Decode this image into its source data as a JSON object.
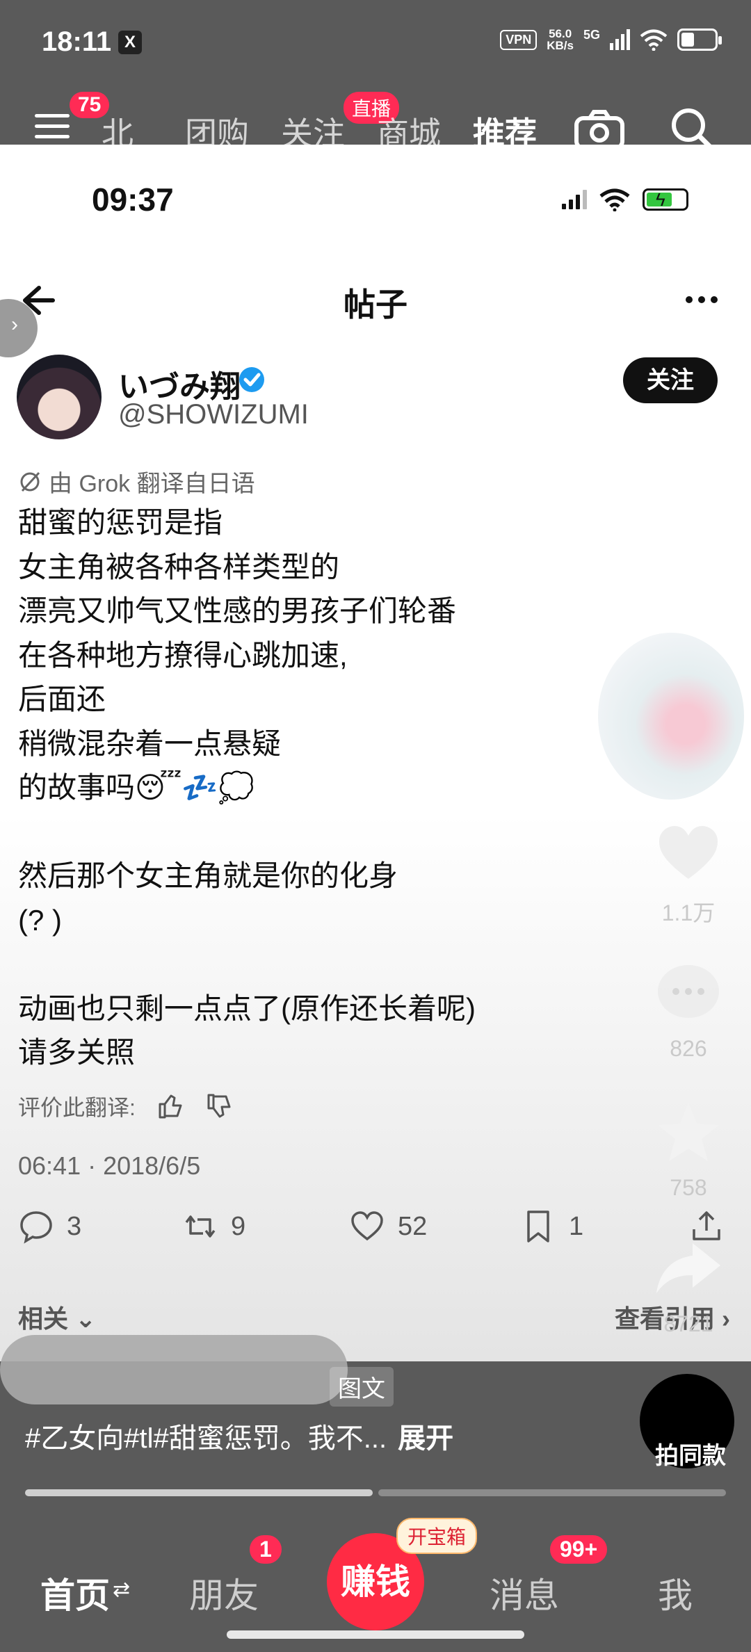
{
  "os_status": {
    "time": "18:11",
    "vpn": "VPN",
    "net_speed_value": "56.0",
    "net_speed_unit": "KB/s",
    "net_type": "5G",
    "app_icon": "X"
  },
  "top_nav": {
    "menu_badge": "75",
    "tabs": [
      "北",
      "团购",
      "关注",
      "商城",
      "推荐"
    ],
    "active_tab": "推荐",
    "live_badge": "直播"
  },
  "inner_status": {
    "time": "09:37"
  },
  "post_header": {
    "title": "帖子"
  },
  "author": {
    "name": "いづみ翔",
    "handle": "@SHOWIZUMI",
    "follow_label": "关注"
  },
  "translation_note": "由 Grok 翻译自日语",
  "body_lines": [
    "甜蜜的惩罚是指",
    "女主角被各种各样类型的",
    "漂亮又帅气又性感的男孩子们轮番",
    "在各种地方撩得心跳加速,",
    "后面还",
    "稍微混杂着一点悬疑",
    "的故事吗😴💤💭",
    "",
    "然后那个女主角就是你的化身",
    "(? )",
    "",
    "动画也只剩一点点了(原作还长着呢)",
    "请多关照"
  ],
  "rate_label": "评价此翻译:",
  "post_date": "06:41 · 2018/6/5",
  "actions": {
    "replies": "3",
    "reposts": "9",
    "likes": "52",
    "bookmarks": "1"
  },
  "related_label": "相关",
  "quotes_label": "查看引用",
  "side_actions": {
    "likes": "1.1万",
    "comments": "826",
    "favorites": "758",
    "shares": "8721"
  },
  "video": {
    "tag_chip": "图文",
    "caption": "#乙女向#tl#甜蜜惩罚。我不...",
    "expand_label": "展开",
    "same_label": "拍同款"
  },
  "bottom_tabs": {
    "home": "首页",
    "friends": "朋友",
    "friends_badge": "1",
    "earn": "赚钱",
    "treasure": "开宝箱",
    "messages": "消息",
    "messages_badge": "99+",
    "me": "我"
  }
}
